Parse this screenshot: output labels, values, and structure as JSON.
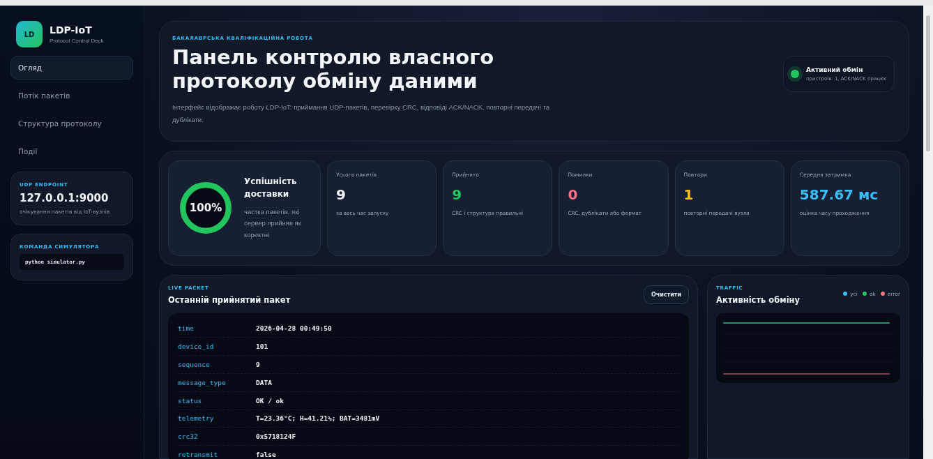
{
  "brand": {
    "logo": "LD",
    "name": "LDP-IoT",
    "subtitle": "Protocol Control Deck"
  },
  "nav": [
    {
      "label": "Огляд",
      "selected": true
    },
    {
      "label": "Потік пакетів",
      "selected": false
    },
    {
      "label": "Структура протоколу",
      "selected": false
    },
    {
      "label": "Події",
      "selected": false
    }
  ],
  "endpoint": {
    "label": "UDP ENDPOINT",
    "value": "127.0.0.1:9000",
    "note": "очікування пакетів від IoT-вузлів"
  },
  "simulator": {
    "label": "КОМАНДА СИМУЛЯТОРА",
    "command": "python simulator.py"
  },
  "hero": {
    "eyebrow": "БАКАЛАВРСЬКА КВАЛІФІКАЦІЙНА РОБОТА",
    "title": "Панель контролю власного протоколу обміну даними",
    "description": "Інтерфейс відображає роботу LDP-IoT: приймання UDP-пакетів, перевірку CRC, відповіді ACK/NACK, повторні передачі та дублікати."
  },
  "status": {
    "title": "Активний обмін",
    "detail": "пристроїв: 1, ACK/NACK працює",
    "color": "#22c55e"
  },
  "success": {
    "value": "100%",
    "level": 1,
    "title": "Успішність доставки",
    "note": "частка пакетів, які сервер прийняв як коректні"
  },
  "stats": [
    {
      "label": "Усього пакетів",
      "value": "9",
      "note": "за весь час запуску",
      "color": "#f1f5f9"
    },
    {
      "label": "Прийнято",
      "value": "9",
      "note": "CRC і структура правильні",
      "color": "#22c55e"
    },
    {
      "label": "Помилки",
      "value": "0",
      "note": "CRC, дублікати або формат",
      "color": "#f87185"
    },
    {
      "label": "Повтори",
      "value": "1",
      "note": "повторні передачі вузла",
      "color": "#fbbf24"
    },
    {
      "label": "Середня затримка",
      "value": "587.67 мс",
      "note": "оцінка часу проходження",
      "color": "#38bdf8"
    }
  ],
  "packet": {
    "eyebrow": "LIVE PACKET",
    "title": "Останній прийнятий пакет",
    "button": "Очистити",
    "fields": [
      {
        "key": "time",
        "value": "2026-04-28 00:49:50"
      },
      {
        "key": "device_id",
        "value": "101"
      },
      {
        "key": "sequence",
        "value": "9"
      },
      {
        "key": "message_type",
        "value": "DATA"
      },
      {
        "key": "status",
        "value": "OK / ok"
      },
      {
        "key": "telemetry",
        "value": "T=23.36°C; H=41.21%; BAT=3481mV"
      },
      {
        "key": "crc32",
        "value": "0x5718124F"
      },
      {
        "key": "retransmit",
        "value": "false"
      }
    ]
  },
  "traffic": {
    "eyebrow": "TRAFFIC",
    "title": "Активність обміну",
    "legend": [
      {
        "label": "усі",
        "color": "#38bdf8"
      },
      {
        "label": "ok",
        "color": "#22c55e"
      },
      {
        "label": "error",
        "color": "#f87185"
      }
    ]
  }
}
